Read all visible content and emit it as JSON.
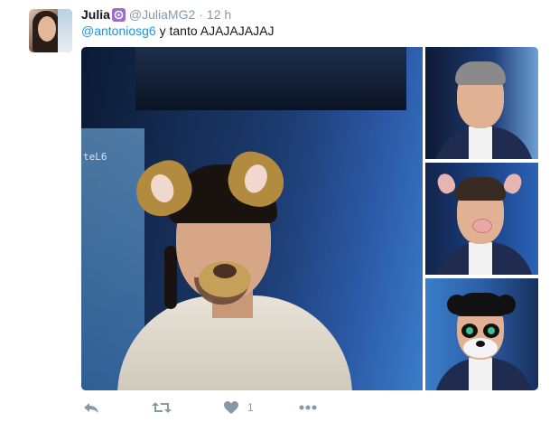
{
  "tweet": {
    "author_name": "Julia",
    "handle": "@JuliaMG2",
    "separator": "·",
    "time": "12 h",
    "mention": "@antoniosg6",
    "text": " y tanto AJAJAJAJAJ"
  },
  "actions": {
    "like_count": "1"
  },
  "colors": {
    "link": "#1b95e0",
    "muted": "#8899a6",
    "badge": "#9d6bd1",
    "action_icon": "#8899a6"
  },
  "icons": [
    "reply-icon",
    "retweet-icon",
    "heart-icon",
    "more-icon",
    "verified-style-badge-icon"
  ]
}
